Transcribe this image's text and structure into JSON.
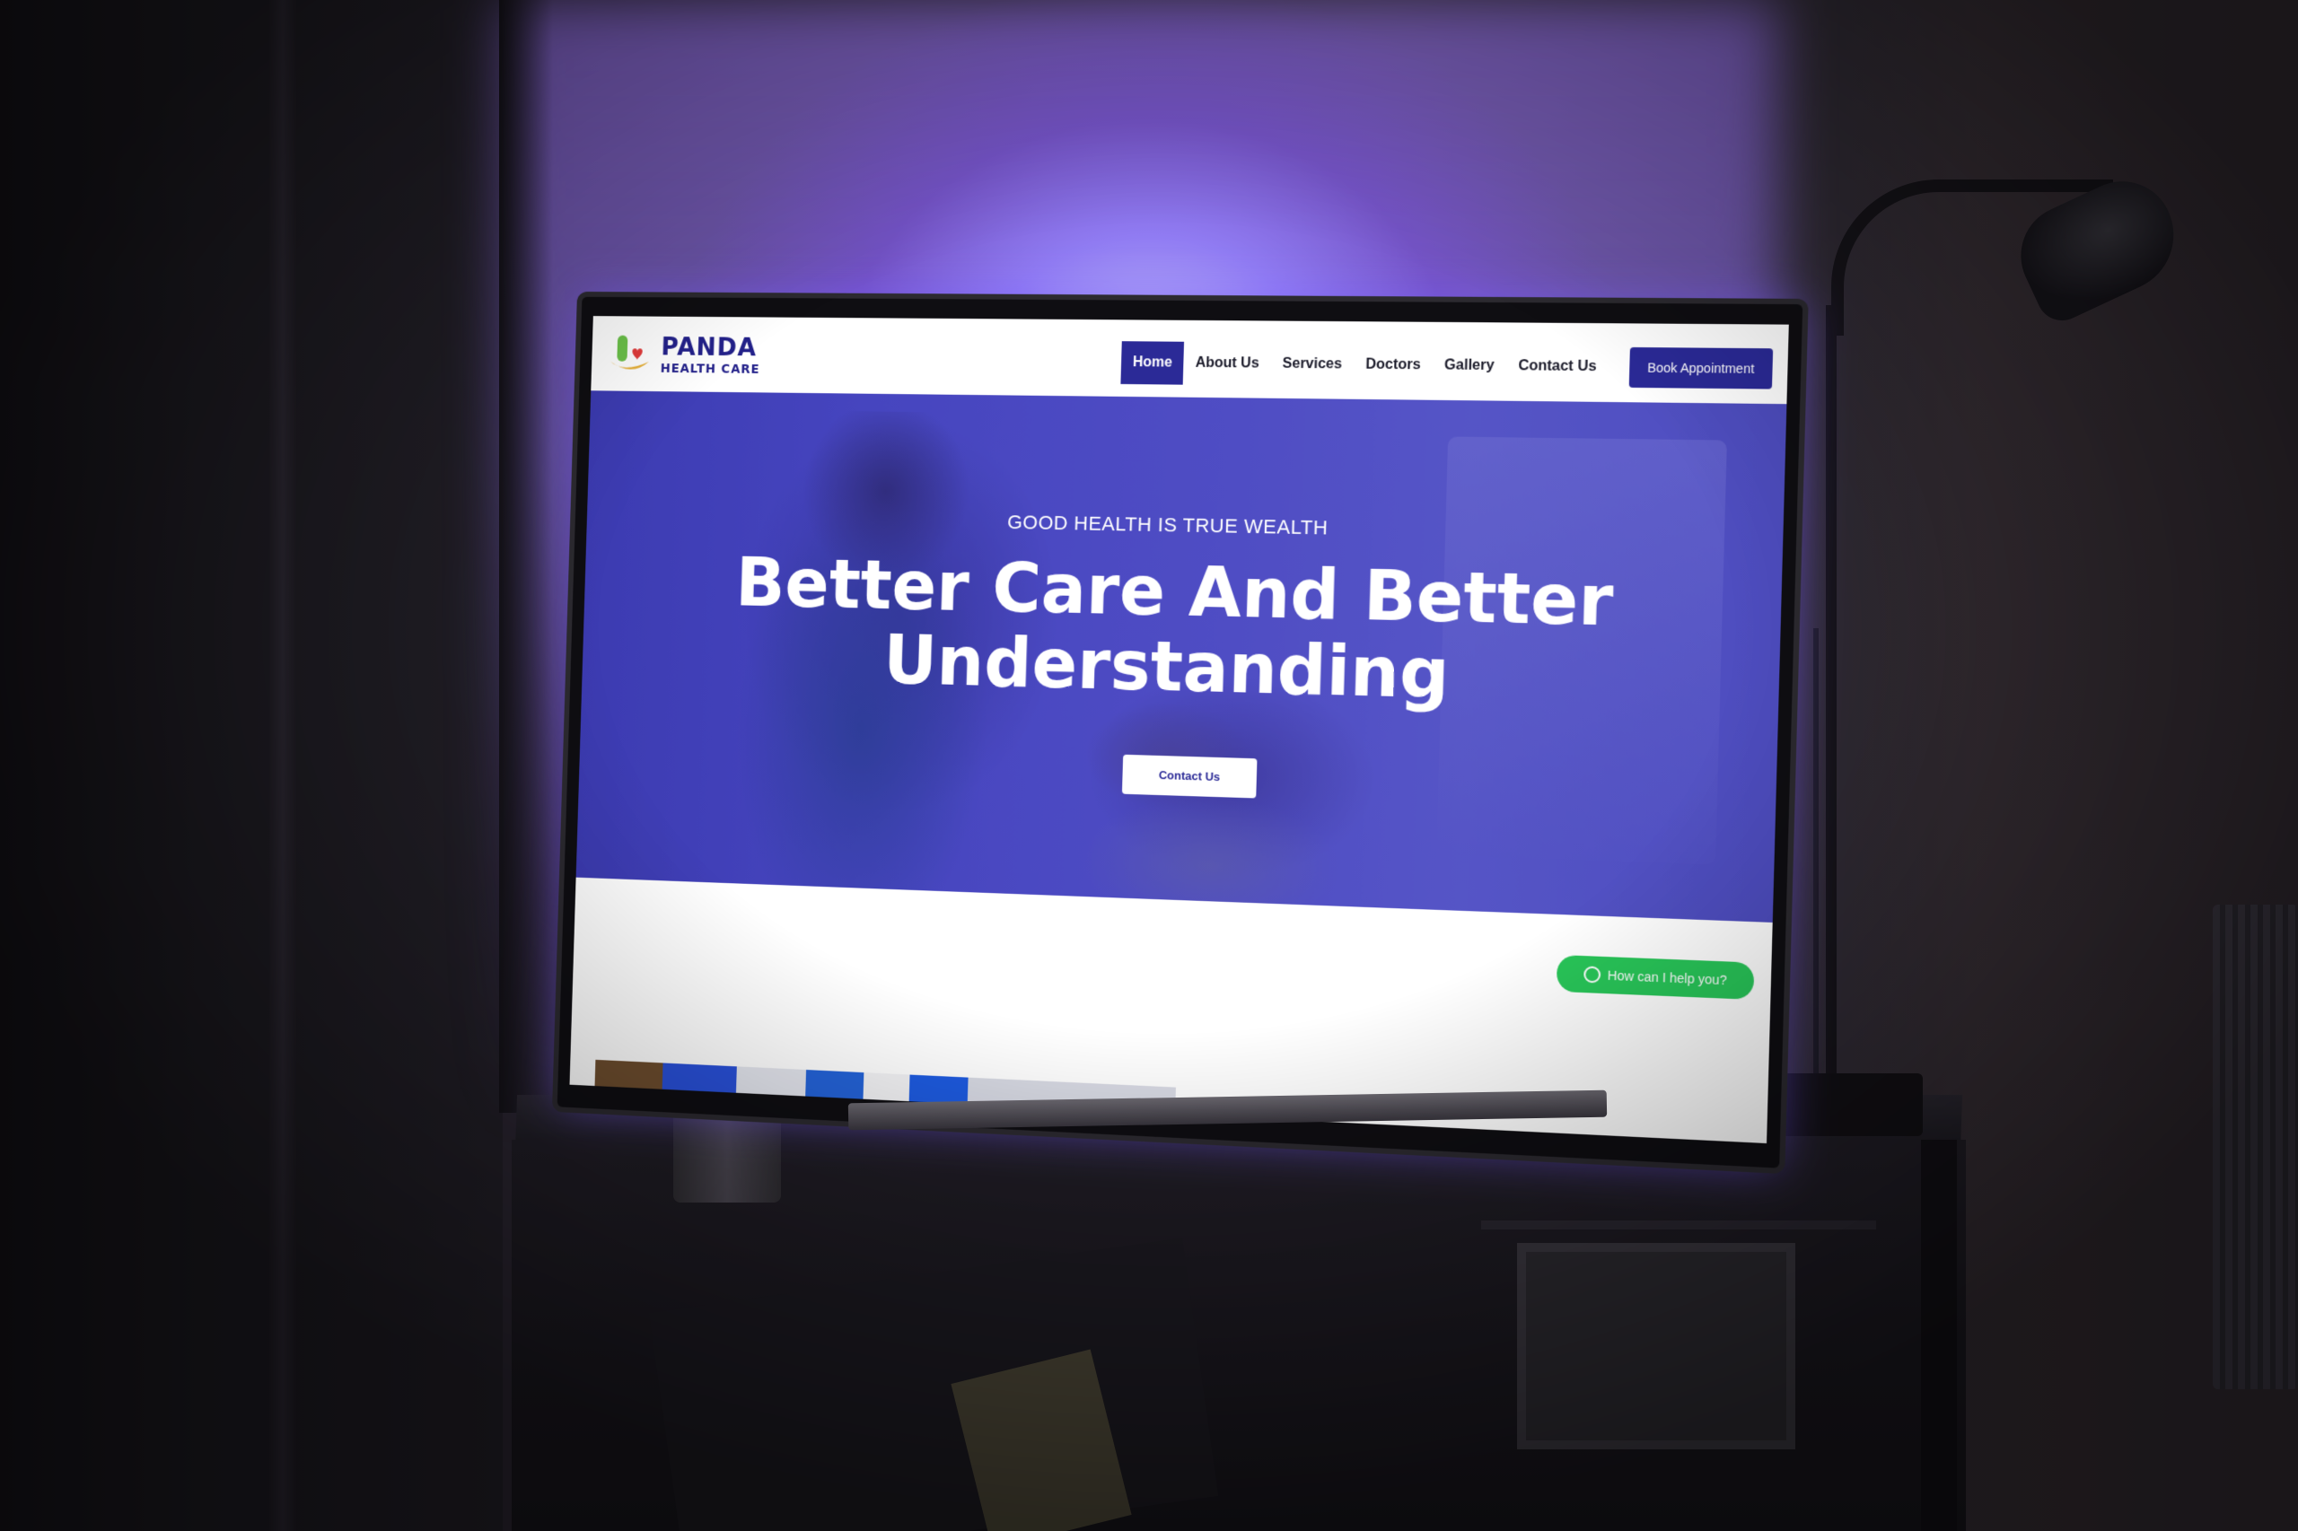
{
  "site": {
    "logo_title": "PANDA",
    "logo_subtitle": "HEALTH CARE",
    "nav": [
      {
        "label": "Home",
        "active": true
      },
      {
        "label": "About Us",
        "active": false
      },
      {
        "label": "Services",
        "active": false
      },
      {
        "label": "Doctors",
        "active": false
      },
      {
        "label": "Gallery",
        "active": false
      },
      {
        "label": "Contact Us",
        "active": false
      }
    ],
    "book_button": "Book Appointment",
    "hero": {
      "tagline": "GOOD HEALTH IS TRUE WEALTH",
      "headline_line1": "Better Care And Better",
      "headline_line2": "Understanding",
      "cta": "Contact Us"
    },
    "chat_widget": "How can I help you?"
  },
  "colors": {
    "brand": "#2b2a97",
    "hero_overlay": "#413ebe",
    "whatsapp": "#29c659",
    "ambient_glow": "#9a7cff"
  },
  "icons": [
    "panda-logo-icon",
    "whatsapp-icon"
  ]
}
